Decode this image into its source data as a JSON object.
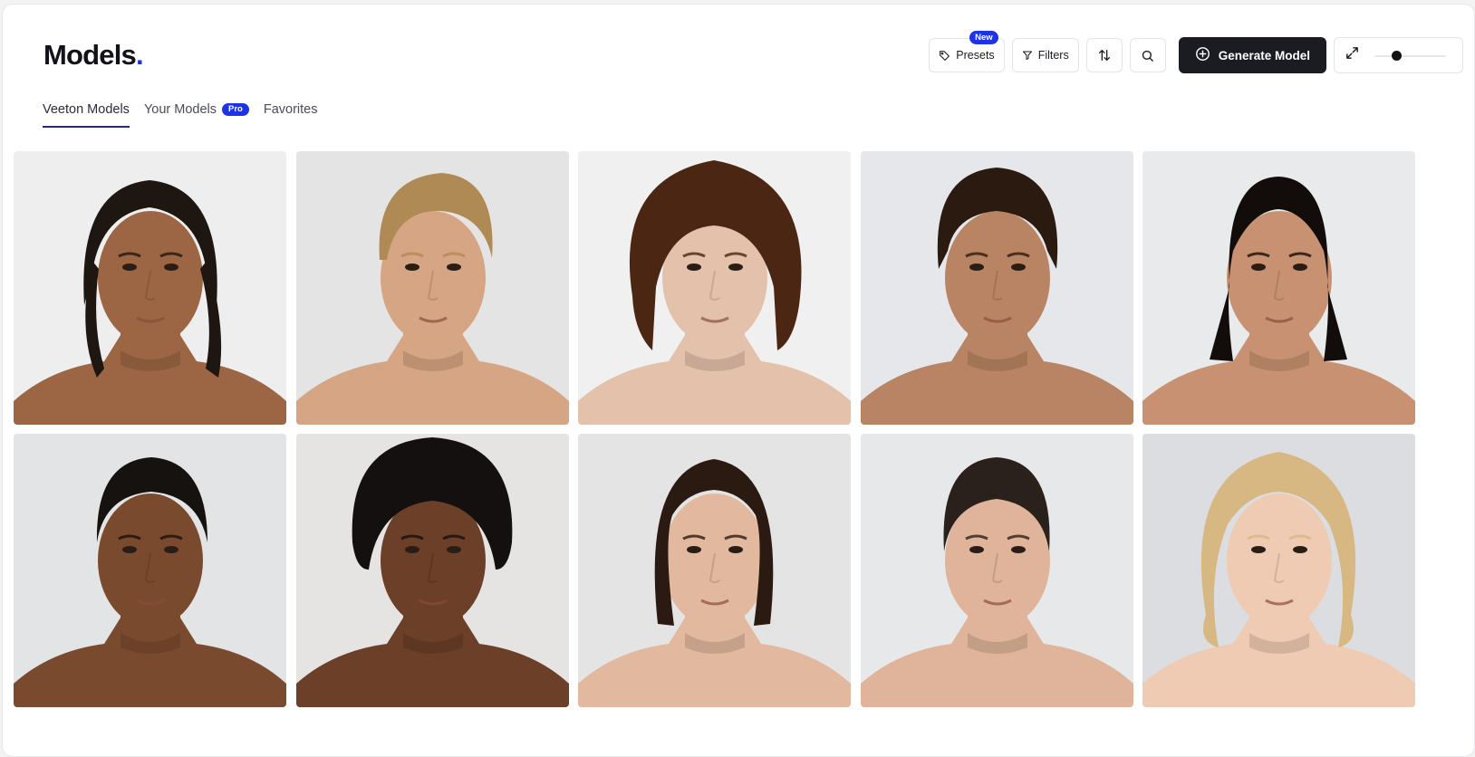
{
  "header": {
    "title": "Models",
    "title_dot": "."
  },
  "toolbar": {
    "presets_label": "Presets",
    "presets_badge": "New",
    "filters_label": "Filters",
    "generate_label": "Generate Model",
    "zoom_level": 0.3
  },
  "tabs": [
    {
      "label": "Veeton Models",
      "active": true
    },
    {
      "label": "Your Models",
      "badge": "Pro",
      "active": false
    },
    {
      "label": "Favorites",
      "active": false
    }
  ],
  "colors": {
    "accent": "#1d33e8",
    "primary_button": "#1b1c22"
  },
  "models": [
    {
      "icon": "model-portrait",
      "bg": "#eeeeee",
      "skin": "#9c6644",
      "hair": "#1e1610",
      "hair_style": "pulled-back-long"
    },
    {
      "icon": "model-portrait",
      "bg": "#e4e4e4",
      "skin": "#d6a583",
      "hair": "#b08a55",
      "hair_style": "short-swept"
    },
    {
      "icon": "model-portrait",
      "bg": "#f0f0f0",
      "skin": "#e3c1aa",
      "hair": "#4a2613",
      "hair_style": "curly-big"
    },
    {
      "icon": "model-portrait",
      "bg": "#e6e7ea",
      "skin": "#b98463",
      "hair": "#2a1a10",
      "hair_style": "curly-short"
    },
    {
      "icon": "model-portrait",
      "bg": "#e9eaec",
      "skin": "#c89272",
      "hair": "#120d0b",
      "hair_style": "straight-long"
    },
    {
      "icon": "model-portrait",
      "bg": "#e3e4e6",
      "skin": "#7a4a2f",
      "hair": "#151210",
      "hair_style": "buzz"
    },
    {
      "icon": "model-portrait",
      "bg": "#e5e4e2",
      "skin": "#6b3f28",
      "hair": "#141010",
      "hair_style": "afro"
    },
    {
      "icon": "model-portrait",
      "bg": "#e4e4e5",
      "skin": "#e2b89e",
      "hair": "#2b1a12",
      "hair_style": "bob"
    },
    {
      "icon": "model-portrait",
      "bg": "#e6e8ea",
      "skin": "#dfb49a",
      "hair": "#2b211c",
      "hair_style": "slicked-back"
    },
    {
      "icon": "model-portrait",
      "bg": "#dcdde0",
      "skin": "#f0cbb3",
      "hair": "#d8b882",
      "hair_style": "wavy-blonde"
    }
  ]
}
